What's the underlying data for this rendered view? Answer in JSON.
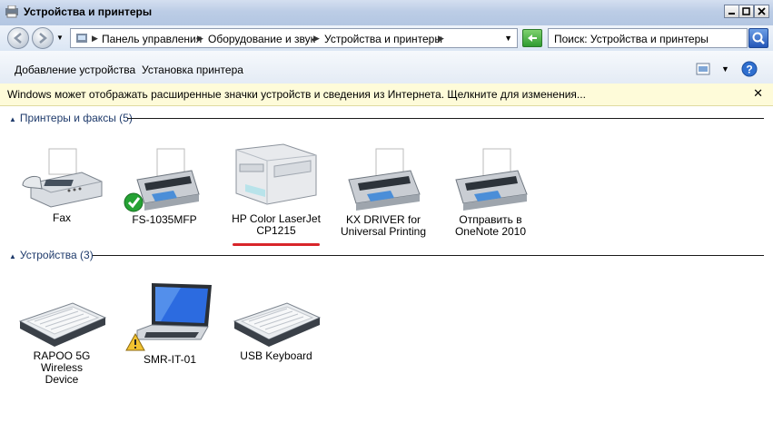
{
  "window": {
    "title": "Устройства и принтеры"
  },
  "navigation": {
    "breadcrumbs": [
      "Панель управления",
      "Оборудование и звук",
      "Устройства и принтеры"
    ],
    "search_placeholder": "Поиск: Устройства и принтеры"
  },
  "toolbar": {
    "add_device": "Добавление устройства",
    "add_printer": "Установка принтера"
  },
  "infobar": {
    "message": "Windows может отображать расширенные значки устройств и сведения из Интернета.  Щелкните для изменения..."
  },
  "groups": {
    "printers": {
      "header": "Принтеры и факсы (5)",
      "items": [
        {
          "name": "Fax",
          "lines": [
            "Fax",
            ""
          ]
        },
        {
          "name": "FS-1035MFP",
          "lines": [
            "FS-1035MFP",
            ""
          ]
        },
        {
          "name": "HP Color LaserJet CP1215",
          "lines": [
            "HP Color LaserJet",
            "CP1215"
          ]
        },
        {
          "name": "KX DRIVER for Universal Printing",
          "lines": [
            "KX DRIVER for",
            "Universal Printing"
          ]
        },
        {
          "name": "Отправить в OneNote 2010",
          "lines": [
            "Отправить в",
            "OneNote 2010"
          ]
        }
      ]
    },
    "devices": {
      "header": "Устройства (3)",
      "items": [
        {
          "name": "RAPOO 5G Wireless Device",
          "lines": [
            "RAPOO 5G Wireless",
            "Device"
          ]
        },
        {
          "name": "SMR-IT-01",
          "lines": [
            "SMR-IT-01",
            ""
          ]
        },
        {
          "name": "USB Keyboard",
          "lines": [
            "USB Keyboard",
            ""
          ]
        }
      ]
    }
  }
}
